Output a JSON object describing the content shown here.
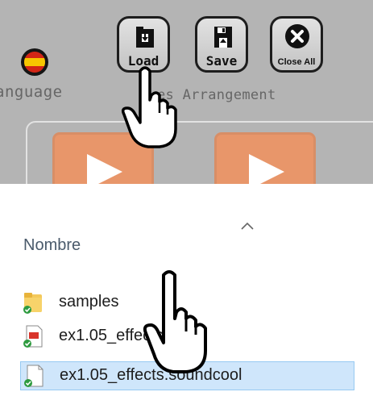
{
  "toolbar": {
    "language_label": "anguage",
    "load_label": "Load",
    "save_label": "Save",
    "close_all_label": "Close All",
    "arrangement_label": "es Arrangement"
  },
  "file_browser": {
    "column_header": "Nombre",
    "rows": [
      {
        "name": "samples",
        "icon": "folder-icon"
      },
      {
        "name": "ex1.05_effects",
        "icon": "pdf-file-icon"
      },
      {
        "name": "ex1.05_effects.soundcool",
        "icon": "file-icon"
      }
    ]
  },
  "colors": {
    "panel_bg": "#b4b4b4",
    "play_button": "#e8966a",
    "selected_row": "#cfe6fb",
    "header_text": "#4a5a6b"
  }
}
